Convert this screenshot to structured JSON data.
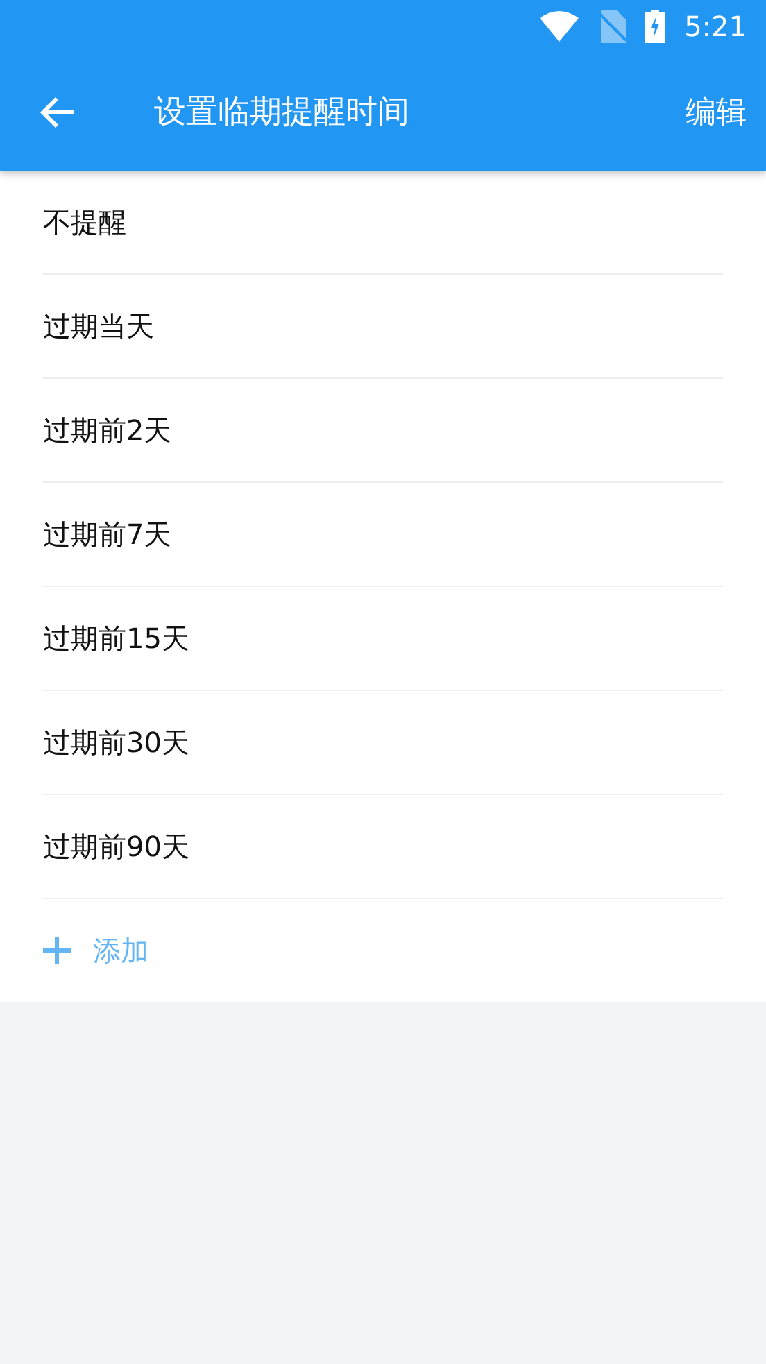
{
  "status_bar": {
    "time": "5:21"
  },
  "app_bar": {
    "title": "设置临期提醒时间",
    "action": "编辑"
  },
  "options": [
    {
      "label": "不提醒"
    },
    {
      "label": "过期当天"
    },
    {
      "label": "过期前2天"
    },
    {
      "label": "过期前7天"
    },
    {
      "label": "过期前15天"
    },
    {
      "label": "过期前30天"
    },
    {
      "label": "过期前90天"
    }
  ],
  "add_button": {
    "label": "添加"
  }
}
